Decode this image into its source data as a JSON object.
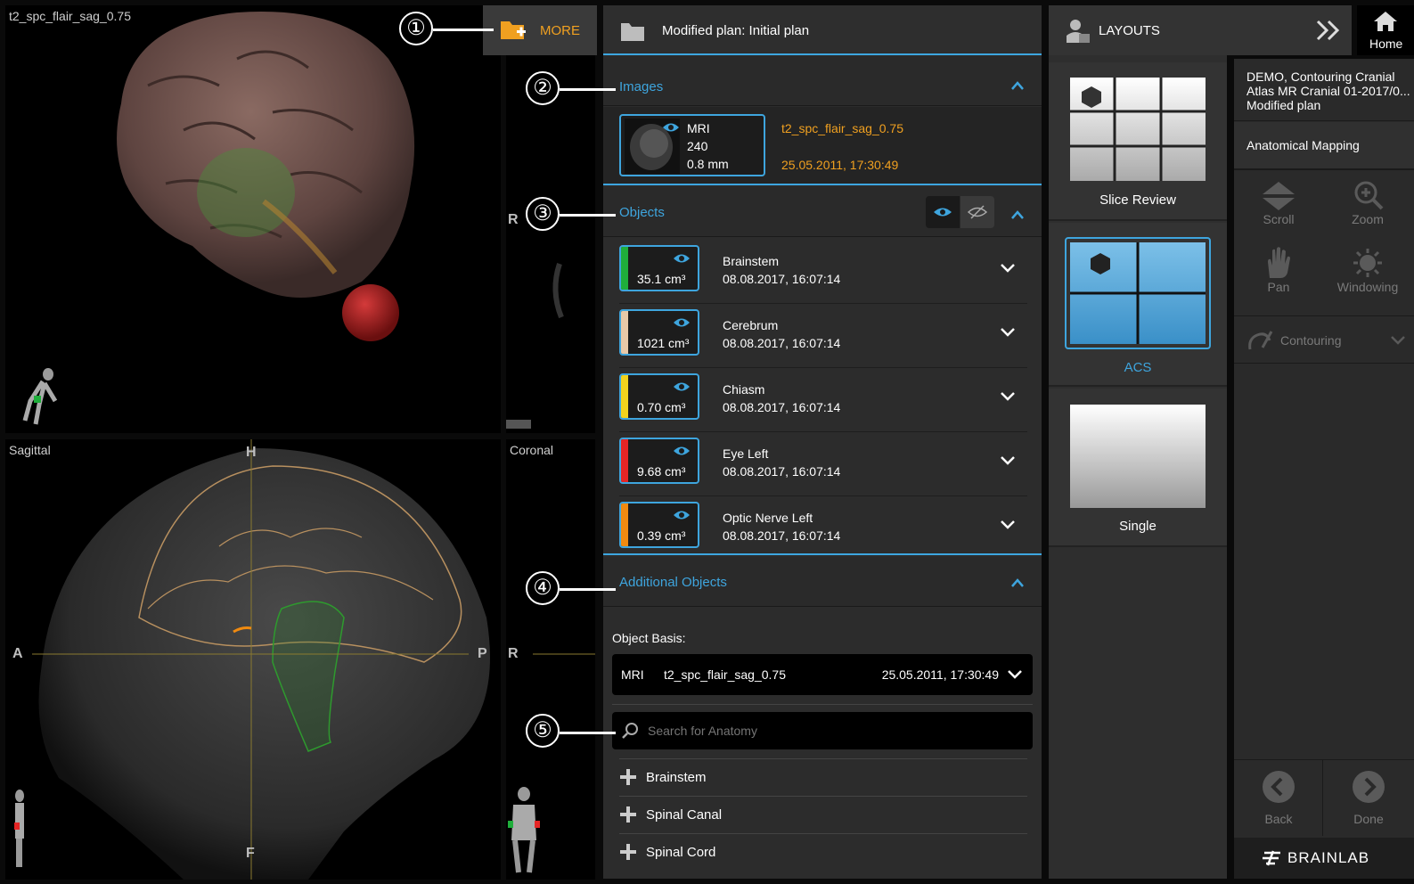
{
  "viewports": {
    "top_left": {
      "label": "t2_spc_flair_sag_0.75"
    },
    "top_right": {
      "orient_left": "R"
    },
    "sagittal": {
      "label": "Sagittal",
      "orient_top": "H",
      "orient_bottom": "F",
      "orient_left": "A",
      "orient_right": "P"
    },
    "coronal": {
      "label": "Coronal",
      "orient_left": "R"
    }
  },
  "more_button": {
    "label": "MORE"
  },
  "plan": {
    "title": "Modified plan: Initial plan"
  },
  "images_section": {
    "title": "Images",
    "image": {
      "modality": "MRI",
      "count": "240",
      "thickness": "0.8 mm",
      "series": "t2_spc_flair_sag_0.75",
      "datetime": "25.05.2011, 17:30:49"
    }
  },
  "objects_section": {
    "title": "Objects",
    "items": [
      {
        "name": "Brainstem",
        "volume": "35.1 cm³",
        "datetime": "08.08.2017, 16:07:14",
        "color": "#1fae3b"
      },
      {
        "name": "Cerebrum",
        "volume": "1021 cm³",
        "datetime": "08.08.2017, 16:07:14",
        "color": "#e8c9a8"
      },
      {
        "name": "Chiasm",
        "volume": "0.70 cm³",
        "datetime": "08.08.2017, 16:07:14",
        "color": "#f2d21c"
      },
      {
        "name": "Eye Left",
        "volume": "9.68 cm³",
        "datetime": "08.08.2017, 16:07:14",
        "color": "#e52525"
      },
      {
        "name": "Optic Nerve Left",
        "volume": "0.39 cm³",
        "datetime": "08.08.2017, 16:07:14",
        "color": "#f08a10"
      }
    ]
  },
  "additional_section": {
    "title": "Additional Objects",
    "basis_label": "Object Basis:",
    "basis": {
      "modality": "MRI",
      "series": "t2_spc_flair_sag_0.75",
      "datetime": "25.05.2011, 17:30:49"
    },
    "search_placeholder": "Search for Anatomy",
    "items": [
      "Brainstem",
      "Spinal Canal",
      "Spinal Cord"
    ]
  },
  "layouts": {
    "title": "LAYOUTS",
    "items": [
      {
        "label": "Slice Review"
      },
      {
        "label": "ACS"
      },
      {
        "label": "Single"
      }
    ]
  },
  "home": {
    "label": "Home"
  },
  "patient": {
    "line1": "DEMO, Contouring Cranial",
    "line2": "Atlas MR Cranial 01-2017/0...",
    "line3": "Modified plan"
  },
  "workflow": {
    "step": "Anatomical Mapping"
  },
  "tools": {
    "scroll": "Scroll",
    "zoom": "Zoom",
    "pan": "Pan",
    "windowing": "Windowing",
    "contouring": "Contouring"
  },
  "nav": {
    "back": "Back",
    "done": "Done"
  },
  "brand": "BRAINLAB",
  "callouts": [
    "①",
    "②",
    "③",
    "④",
    "⑤"
  ]
}
